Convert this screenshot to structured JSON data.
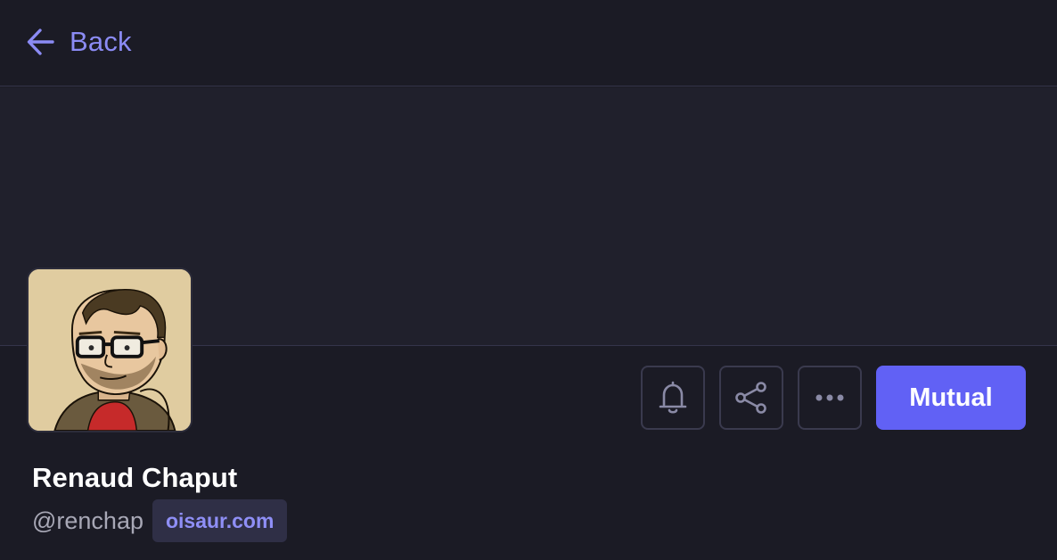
{
  "nav": {
    "back_label": "Back",
    "back_icon": "arrow-left-icon"
  },
  "profile": {
    "display_name": "Renaud Chaput",
    "handle": "@renchap",
    "domain": "oisaur.com",
    "avatar_alt": "Renaud Chaput"
  },
  "actions": {
    "notify_icon": "bell-icon",
    "share_icon": "share-icon",
    "more_icon": "more-horizontal-icon",
    "relationship_label": "Mutual"
  },
  "colors": {
    "background": "#1b1b25",
    "banner": "#20202c",
    "accent": "#6161f5",
    "link": "#8b8bf4",
    "muted_text": "#a8a8b6",
    "border": "#3a3a4e"
  }
}
